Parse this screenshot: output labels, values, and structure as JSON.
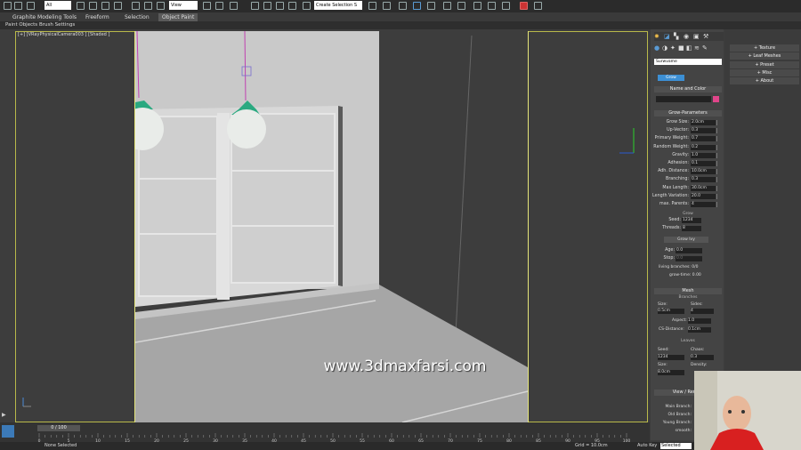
{
  "toolbar": {
    "filter_value": "All",
    "view_value": "View",
    "selection_set": "Create Selection S"
  },
  "ribbon": {
    "tabs": [
      "Graphite Modeling Tools",
      "Freeform",
      "Selection",
      "Object Paint"
    ],
    "active_tab": "Object Paint",
    "subtabs": [
      "Paint Objects",
      "Brush Settings"
    ]
  },
  "viewport": {
    "label": "[+] [VRayPhysicalCamera003 ] [Shaded ]",
    "watermark": "www.3dmaxfarsi.com"
  },
  "command_panel": {
    "dropdown": "Surwvame",
    "active_button": "Grow",
    "name_color_header": "Name and Color",
    "grow_params_header": "Grow-Parameters",
    "params": [
      {
        "label": "Grow Size:",
        "value": "2.0cm"
      },
      {
        "label": "Up-Vector:",
        "value": "0.3"
      },
      {
        "label": "Primary Weight:",
        "value": "0.7"
      },
      {
        "label": "Random Weight:",
        "value": "0.2"
      },
      {
        "label": "Gravity:",
        "value": "1.0"
      },
      {
        "label": "Adhesion:",
        "value": "0.1"
      },
      {
        "label": "Adh. Distance:",
        "value": "10.0cm"
      },
      {
        "label": "Branching:",
        "value": "0.3"
      },
      {
        "label": "Max Length:",
        "value": "30.0cm"
      },
      {
        "label": "Length Variation:",
        "value": "20.0"
      },
      {
        "label": "max. Parents:",
        "value": "4"
      }
    ],
    "grow_sub": "Grow",
    "seed_label": "Seed:",
    "seed_value": "1234",
    "threads_label": "Threads:",
    "threads_value": "8",
    "grow_ivy_button": "Grow Ivy",
    "age_label": "Age:",
    "age_value": "0.0",
    "stop_label": "Stop:",
    "stop_value": "0.0",
    "living_branches": "living branches: 0/0",
    "grow_time": "grow-time: 0.00",
    "mesh_header": "Mesh",
    "branches_sub": "Branches",
    "size_label": "Size:",
    "size_value": "0.5cm",
    "sides_label": "Sides:",
    "sides_value": "4",
    "aspect_label": "Aspect:",
    "aspect_value": "1.0",
    "cs_label": "CS-Distance:",
    "cs_value": "0.1cm",
    "leaves_sub": "Leaves",
    "lseed_label": "Seed:",
    "lseed_value": "1234",
    "chaos_label": "Chaos:",
    "chaos_value": "0.3",
    "lsize_label": "Size:",
    "lsize_value": "8.0cm",
    "density_label": "Density:",
    "view_header": "View / Render",
    "view_items": [
      "Main Branch:",
      "Old Branch:",
      "Young Branch:",
      "smooth:"
    ]
  },
  "right_panel": {
    "buttons": [
      "Texture",
      "Leaf Meshes",
      "Preset",
      "Misc",
      "About"
    ]
  },
  "timeline": {
    "slider": "0 / 100",
    "ticks": [
      "0",
      "5",
      "10",
      "15",
      "20",
      "25",
      "30",
      "35",
      "40",
      "45",
      "50",
      "55",
      "60",
      "65",
      "70",
      "75",
      "80",
      "85",
      "90",
      "95",
      "100"
    ]
  },
  "status": {
    "selection": "None Selected",
    "grid": "Grid = 10.0cm",
    "autokey": "Auto Key",
    "selected": "Selected"
  },
  "colors": {
    "accent": "#3c8fd4",
    "viewport_border": "#e5e57a",
    "lamp_shade": "#2aa980",
    "name_swatch": "#e0458a"
  }
}
